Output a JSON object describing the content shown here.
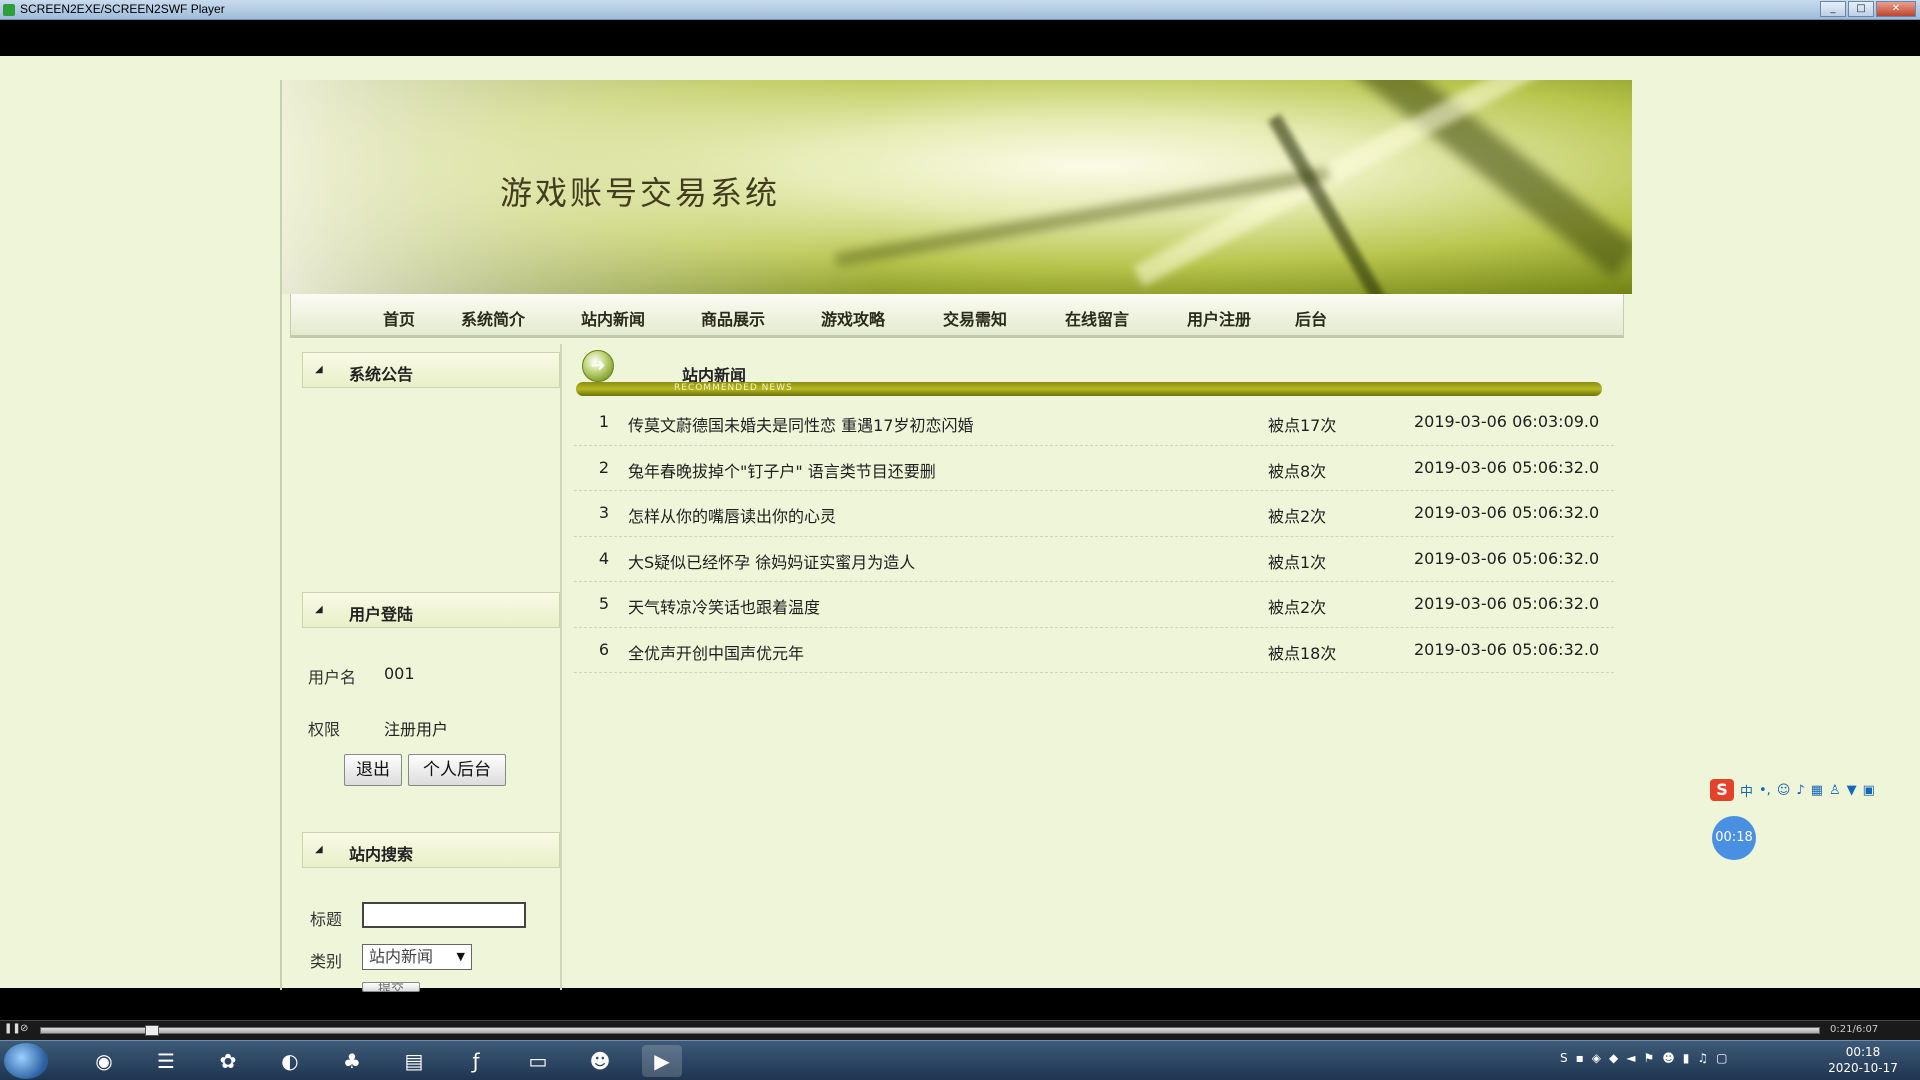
{
  "window": {
    "title": "SCREEN2EXE/SCREEN2SWF Player",
    "minimize": "_",
    "maximize": "□",
    "close": "✕"
  },
  "site": {
    "title": "游戏账号交易系统"
  },
  "nav": {
    "items": [
      {
        "label": "首页"
      },
      {
        "label": "系统简介"
      },
      {
        "label": "站内新闻"
      },
      {
        "label": "商品展示"
      },
      {
        "label": "游戏攻略"
      },
      {
        "label": "交易需知"
      },
      {
        "label": "在线留言"
      },
      {
        "label": "用户注册"
      },
      {
        "label": "后台"
      }
    ]
  },
  "sidebar": {
    "announcement": {
      "title": "系统公告"
    },
    "login": {
      "title": "用户登陆",
      "username_label": "用户名",
      "username_value": "001",
      "role_label": "权限",
      "role_value": "注册用户",
      "logout_button": "退出",
      "profile_button": "个人后台"
    },
    "search": {
      "title": "站内搜索",
      "title_label": "标题",
      "title_value": "",
      "category_label": "类别",
      "category_value": "站内新闻",
      "submit_button": "提交"
    }
  },
  "main": {
    "title": "站内新闻",
    "subtitle": "RECOMMENDED NEWS",
    "news": [
      {
        "num": "1",
        "title": "传莫文蔚德国未婚夫是同性恋 重遇17岁初恋闪婚",
        "hits": "被点17次",
        "date": "2019-03-06 06:03:09.0"
      },
      {
        "num": "2",
        "title": "兔年春晚拔掉个\"钉子户\" 语言类节目还要删",
        "hits": "被点8次",
        "date": "2019-03-06 05:06:32.0"
      },
      {
        "num": "3",
        "title": "怎样从你的嘴唇读出你的心灵",
        "hits": "被点2次",
        "date": "2019-03-06 05:06:32.0"
      },
      {
        "num": "4",
        "title": "大S疑似已经怀孕 徐妈妈证实蜜月为造人",
        "hits": "被点1次",
        "date": "2019-03-06 05:06:32.0"
      },
      {
        "num": "5",
        "title": "天气转凉冷笑话也跟着温度",
        "hits": "被点2次",
        "date": "2019-03-06 05:06:32.0"
      },
      {
        "num": "6",
        "title": "全优声开创中国声优元年",
        "hits": "被点18次",
        "date": "2019-03-06 05:06:32.0"
      }
    ]
  },
  "overlay": {
    "ime_logo": "S",
    "ime_mode": "中",
    "timer": "00:18"
  },
  "player": {
    "time": "0:21/6:07"
  },
  "taskbar": {
    "clock_time": "00:18",
    "clock_date": "2020-10-17"
  }
}
